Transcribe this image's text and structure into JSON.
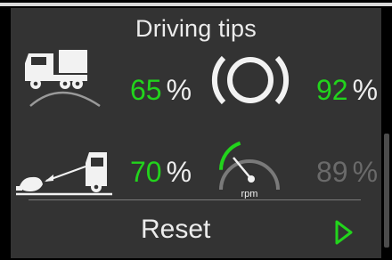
{
  "title": "Driving tips",
  "metrics": [
    {
      "value": "65",
      "unit": "%",
      "icon": "truck-hill-icon",
      "state": "active"
    },
    {
      "value": "92",
      "unit": "%",
      "icon": "tire-brake-icon",
      "state": "active"
    },
    {
      "value": "70",
      "unit": "%",
      "icon": "truck-coasting-icon",
      "state": "active"
    },
    {
      "value": "89",
      "unit": "%",
      "icon": "rpm-gauge-icon",
      "state": "dimmed"
    }
  ],
  "gauge": {
    "label": "rpm",
    "level": 0.3
  },
  "reset_label": "Reset",
  "colors": {
    "accent": "#22d41c",
    "background": "#333333",
    "text": "#ececec",
    "dimmed": "#6a6a6a"
  }
}
